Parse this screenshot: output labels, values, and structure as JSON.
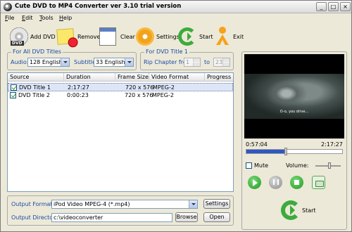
{
  "window": {
    "title": "Cute DVD to MP4 Converter ver 3.10  trial version"
  },
  "menu": [
    "File",
    "Edit",
    "Tools",
    "Help"
  ],
  "toolbar": {
    "add_dvd": "Add DVD",
    "remove": "Remove",
    "clear": "Clear",
    "settings": "Settings",
    "start": "Start",
    "exit": "Exit"
  },
  "all_titles": {
    "group_title": "For All DVD Titles",
    "audio_label": "Audio:",
    "audio_value": "128  English",
    "subtitle_label": "Subtitle:",
    "subtitle_value": "33  English"
  },
  "title1": {
    "group_title": "For DVD Title 1",
    "rip_label": "Rip Chapter from:",
    "from_value": "1",
    "to_label": "to",
    "to_value": "23"
  },
  "table": {
    "columns": [
      "Source",
      "Duration",
      "Frame Size",
      "Video Format",
      "Progress"
    ],
    "rows": [
      {
        "source": "DVD Title 1",
        "duration": "2:17:27",
        "frame": "720 x 576",
        "format": "MPEG-2",
        "progress": ""
      },
      {
        "source": "DVD Title 2",
        "duration": "0:00:23",
        "frame": "720 x 576",
        "format": "MPEG-2",
        "progress": ""
      }
    ]
  },
  "output": {
    "format_label": "Output Format:",
    "format_value": "iPod Video MPEG-4 (*.mp4)",
    "dir_label": "Output Directory:",
    "dir_value": "c:\\videoconverter",
    "settings_btn": "Settings",
    "browse_btn": "Browse",
    "open_btn": "Open"
  },
  "preview": {
    "subtitle_text": "O-o, you drive...",
    "time_current": "0:57:04",
    "time_total": "2:17:27",
    "progress_fraction": 0.41,
    "mute_label": "Mute",
    "volume_label": "Volume:",
    "volume_fraction": 0.55
  },
  "big_start_label": "Start"
}
